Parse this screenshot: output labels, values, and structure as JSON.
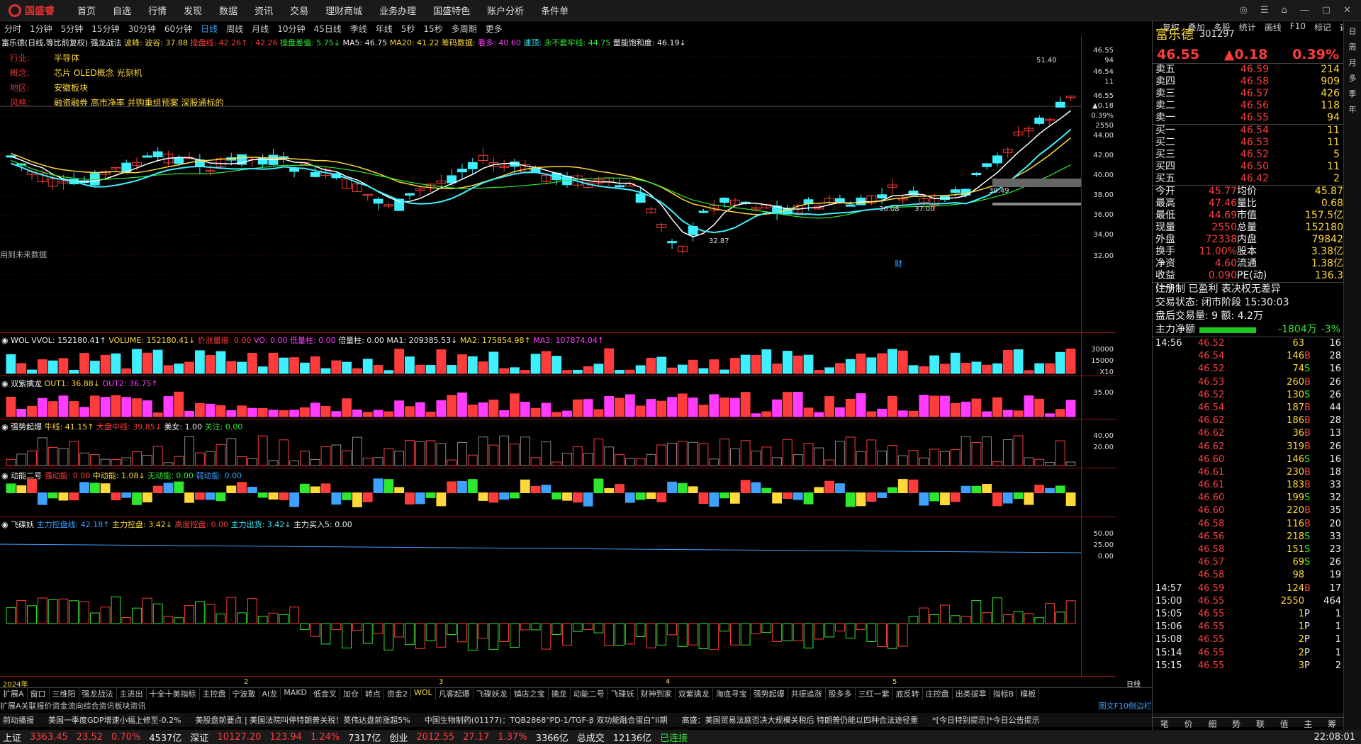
{
  "app": {
    "brand": "国盛睿",
    "nav": [
      "首页",
      "自选",
      "行情",
      "发现",
      "数据",
      "资讯",
      "交易",
      "理财商城",
      "业务办理",
      "国盛特色",
      "账户分析",
      "条件单"
    ]
  },
  "periods": [
    "分时",
    "1分钟",
    "5分钟",
    "15分钟",
    "30分钟",
    "60分钟",
    "日线",
    "周线",
    "月线",
    "10分钟",
    "45日线",
    "季线",
    "年线",
    "5秒",
    "15秒",
    "多周期",
    "更多"
  ],
  "active_period": "日线",
  "tools": [
    "复权",
    "叠加",
    "多股",
    "统计",
    "画线",
    "F10",
    "标记",
    "返回"
  ],
  "main": {
    "title": "富乐德(日线,等比前复权)",
    "indicator": "强龙战法",
    "params": [
      {
        "t": "波峰:",
        "v": "",
        "c": "yellow"
      },
      {
        "t": "波谷: 37.88",
        "c": "yellow"
      },
      {
        "t": "操盘线: 42.26↑",
        "c": "red"
      },
      {
        "t": ": 42.26",
        "c": "red"
      },
      {
        "t": "操盘差值: 5.75↓",
        "c": "green"
      },
      {
        "t": "MA5: 46.75",
        "c": "white"
      },
      {
        "t": "MA20: 41.22",
        "c": "yellow"
      },
      {
        "t": "筹码数据:",
        "c": "yellow"
      },
      {
        "t": "看多: 40.60",
        "c": "magenta"
      },
      {
        "t": "速顶:",
        "c": "cyan"
      },
      {
        "t": "永不套牢线: 44.75",
        "c": "green"
      },
      {
        "t": "量能饱和度: 46.19↓",
        "c": "white"
      }
    ],
    "info": [
      {
        "k": "行业:",
        "v": "半导体"
      },
      {
        "k": "概念:",
        "v": "芯片 OLED概念 光刻机"
      },
      {
        "k": "地区:",
        "v": "安徽板块"
      },
      {
        "k": "风格:",
        "v": "融资融券 高市净率 并购重组预案 深股通标的"
      }
    ],
    "annotations": {
      "high": "51.40",
      "low1": "32.87",
      "low2": "36.08",
      "level": "37.00",
      "marker": "39.49",
      "future_note": "用到未来数据",
      "fin": "财"
    },
    "axis": [
      "46.55",
      "94",
      "46.54",
      "11",
      "46.55",
      "▲0.18",
      "0.39%",
      "2550",
      "44.00",
      "42.00",
      "40.00",
      "38.00",
      "36.00",
      "34.00",
      "32.00"
    ],
    "months": [
      "2024年",
      "2",
      "3",
      "4",
      "5",
      "日线"
    ]
  },
  "subpanels": [
    {
      "name": "WOL",
      "params": [
        {
          "t": "VVOL: 152180.41↑",
          "c": "white"
        },
        {
          "t": "VOLUME: 152180.41↓",
          "c": "yellow"
        },
        {
          "t": "价涨量缩: 0.00",
          "c": "red"
        },
        {
          "t": "VO: 0.00",
          "c": "magenta"
        },
        {
          "t": "低量柱: 0.00",
          "c": "magenta"
        },
        {
          "t": "倍量柱: 0.00",
          "c": "white"
        },
        {
          "t": "MA1: 209385.53↓",
          "c": "white"
        },
        {
          "t": "MA2: 175854.98↑",
          "c": "yellow"
        },
        {
          "t": "MA3: 107874.04↑",
          "c": "magenta"
        }
      ],
      "axis": [
        "30000",
        "15000",
        "X10"
      ]
    },
    {
      "name": "双紫擒龙",
      "params": [
        {
          "t": "OUT1: 36.88↓",
          "c": "yellow"
        },
        {
          "t": "OUT2: 36.75↑",
          "c": "magenta"
        }
      ],
      "axis": [
        "35.00"
      ]
    },
    {
      "name": "强势起爆",
      "params": [
        {
          "t": "牛线: 41.15↑",
          "c": "yellow"
        },
        {
          "t": "大盘中线: 39.85↓",
          "c": "red"
        },
        {
          "t": "美女: 1.00",
          "c": "white"
        },
        {
          "t": "关注: 0.00",
          "c": "green"
        }
      ],
      "axis": [
        "40.00",
        "20.00"
      ]
    },
    {
      "name": "动能二号",
      "params": [
        {
          "t": "强动能: 0.00",
          "c": "red"
        },
        {
          "t": "中动能: 1.08↓",
          "c": "yellow"
        },
        {
          "t": "无动能: 0.00",
          "c": "green"
        },
        {
          "t": "弱动能: 0.00",
          "c": "blue"
        }
      ],
      "axis": []
    },
    {
      "name": "飞碟妖",
      "params": [
        {
          "t": "主力控盘线: 42.18↑",
          "c": "blue"
        },
        {
          "t": "主力控盘: 3.42↓",
          "c": "yellow"
        },
        {
          "t": "高度控盘: 0.00",
          "c": "red"
        },
        {
          "t": "主力出货: 3.42↓",
          "c": "cyan"
        },
        {
          "t": "主力买入5: 0.00",
          "c": "white"
        }
      ],
      "axis": [
        "50.00",
        "25.00",
        "0.00"
      ]
    }
  ],
  "bottom_tabs": [
    "扩展A",
    "窗口",
    "三维阳",
    "强龙战法",
    "主进出",
    "十全十美指标",
    "主控盘",
    "宁波敢",
    "AI龙",
    "MAKD",
    "低金叉",
    "加仓",
    "转点",
    "资金2",
    "WOL",
    "凡客起爆",
    "飞碟妖龙",
    "镇店之宝",
    "擒龙",
    "动能二号",
    "飞碟妖",
    "财神到家",
    "双紫擒龙",
    "海底寻宝",
    "强势起爆",
    "共振追涨",
    "股多多",
    "三红一紫",
    "底反转",
    "庄控盘",
    "出类拔萃",
    "指标B",
    "模板"
  ],
  "active_tab": "WOL",
  "bottom_tabs2": [
    "扩展A",
    "关联报价",
    "资金流向",
    "综合资讯",
    "板块资讯"
  ],
  "f10_labels": [
    "图文F10",
    "侧边栏"
  ],
  "ticker": [
    "前动播报",
    "美国一季度GDP增速小幅上修至-0.2%",
    "美股盘前要点 | 美国法院叫停特朗普关税！英伟达盘前涨超5%",
    "中国生物制药(01177)：TQB2868“PD-1/TGF-β 双功能融合蛋白”II期",
    "高盛：美国贸易法庭否决大规模关税后 特朗普仍能以四种合法途径重",
    "*[今日特别提示]*今日公告提示"
  ],
  "index": [
    {
      "n": "上证",
      "v": "3363.45",
      "c": "23.52",
      "p": "0.70%",
      "a": "4537亿"
    },
    {
      "n": "深证",
      "v": "10127.20",
      "c": "123.94",
      "p": "1.24%",
      "a": "7317亿"
    },
    {
      "n": "创业",
      "v": "2012.55",
      "c": "27.17",
      "p": "1.37%",
      "a": "3366亿"
    }
  ],
  "total": {
    "label": "总成交",
    "v": "12136亿"
  },
  "conn": "已连接",
  "clock": "22:08:01",
  "quote": {
    "name": "富乐德",
    "code": "301297",
    "price": "46.55",
    "chg": "▲0.18",
    "pct": "0.39%",
    "asks": [
      [
        "卖五",
        "46.59",
        "214"
      ],
      [
        "卖四",
        "46.58",
        "909"
      ],
      [
        "卖三",
        "46.57",
        "426"
      ],
      [
        "卖二",
        "46.56",
        "118"
      ],
      [
        "卖一",
        "46.55",
        "94"
      ]
    ],
    "bids": [
      [
        "买一",
        "46.54",
        "11"
      ],
      [
        "买二",
        "46.53",
        "11"
      ],
      [
        "买三",
        "46.52",
        "5"
      ],
      [
        "买四",
        "46.50",
        "11"
      ],
      [
        "买五",
        "46.42",
        "2"
      ]
    ],
    "stats": [
      [
        "今开",
        "45.77",
        "均价",
        "45.87"
      ],
      [
        "最高",
        "47.46",
        "量比",
        "0.68"
      ],
      [
        "最低",
        "44.69",
        "市值",
        "157.5亿"
      ],
      [
        "现量",
        "2550",
        "总量",
        "152180"
      ],
      [
        "外盘",
        "72338",
        "内盘",
        "79842"
      ],
      [
        "换手",
        "11.00%",
        "股本",
        "3.38亿"
      ],
      [
        "净资",
        "4.60",
        "流通",
        "1.38亿"
      ],
      [
        "收益(一)",
        "0.090",
        "PE(动)",
        "136.3"
      ]
    ],
    "notes": [
      "注册制 已盈利 表决权无差异",
      "交易状态: 闭市阶段 15:30:03",
      "盘后交易量: 9  额: 4.2万"
    ],
    "flow": {
      "label": "主力净额",
      "v": "-1804万",
      "p": "-3%"
    },
    "ticks": [
      [
        "14:56",
        "46.52",
        "63",
        "",
        "16"
      ],
      [
        "",
        "46.54",
        "146",
        "B",
        "28"
      ],
      [
        "",
        "46.52",
        "74",
        "S",
        "16"
      ],
      [
        "",
        "46.53",
        "260",
        "B",
        "26"
      ],
      [
        "",
        "46.52",
        "130",
        "S",
        "26"
      ],
      [
        "",
        "46.54",
        "187",
        "B",
        "44"
      ],
      [
        "",
        "46.62",
        "186",
        "B",
        "28"
      ],
      [
        "",
        "46.62",
        "36",
        "B",
        "13"
      ],
      [
        "",
        "46.62",
        "319",
        "B",
        "26"
      ],
      [
        "",
        "46.60",
        "146",
        "S",
        "16"
      ],
      [
        "",
        "46.61",
        "230",
        "B",
        "18"
      ],
      [
        "",
        "46.61",
        "183",
        "B",
        "33"
      ],
      [
        "",
        "46.60",
        "199",
        "S",
        "32"
      ],
      [
        "",
        "46.60",
        "220",
        "B",
        "35"
      ],
      [
        "",
        "46.58",
        "116",
        "B",
        "20"
      ],
      [
        "",
        "46.56",
        "218",
        "S",
        "33"
      ],
      [
        "",
        "46.58",
        "151",
        "S",
        "23"
      ],
      [
        "",
        "46.57",
        "69",
        "S",
        "26"
      ],
      [
        "",
        "46.58",
        "98",
        "",
        "19"
      ],
      [
        "14:57",
        "46.59",
        "124",
        "B",
        "17"
      ],
      [
        "15:00",
        "46.55",
        "2550",
        "",
        "464"
      ],
      [
        "15:05",
        "46.55",
        "1",
        "P",
        "1"
      ],
      [
        "15:06",
        "46.55",
        "1",
        "P",
        "1"
      ],
      [
        "15:08",
        "46.55",
        "2",
        "P",
        "1"
      ],
      [
        "15:14",
        "46.55",
        "2",
        "P",
        "1"
      ],
      [
        "15:15",
        "46.55",
        "3",
        "P",
        "2"
      ]
    ],
    "tabs": [
      "笔",
      "价",
      "细",
      "势",
      "联",
      "值",
      "主",
      "筹"
    ]
  },
  "side": [
    "日",
    "周",
    "月",
    "多",
    "季",
    "年"
  ]
}
